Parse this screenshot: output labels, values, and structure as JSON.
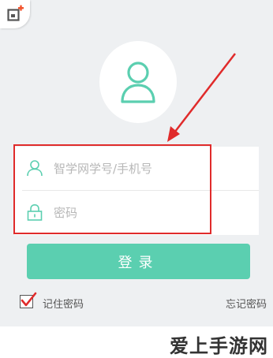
{
  "badge": {
    "icon": "app-plus-icon",
    "accent": "#f2542d"
  },
  "avatar": {
    "icon": "user-avatar-icon",
    "color": "#5bcfb0"
  },
  "form": {
    "username_placeholder": "智学网学号/手机号",
    "password_placeholder": "密码",
    "username_icon": "user-icon",
    "password_icon": "lock-icon",
    "highlight_color": "#e02b2b"
  },
  "login": {
    "label": "登录",
    "color": "#5bcfb0"
  },
  "remember": {
    "label": "记住密码",
    "checked": true
  },
  "forgot": {
    "label": "忘记密码"
  },
  "watermark": {
    "text": "爱上手游网"
  }
}
